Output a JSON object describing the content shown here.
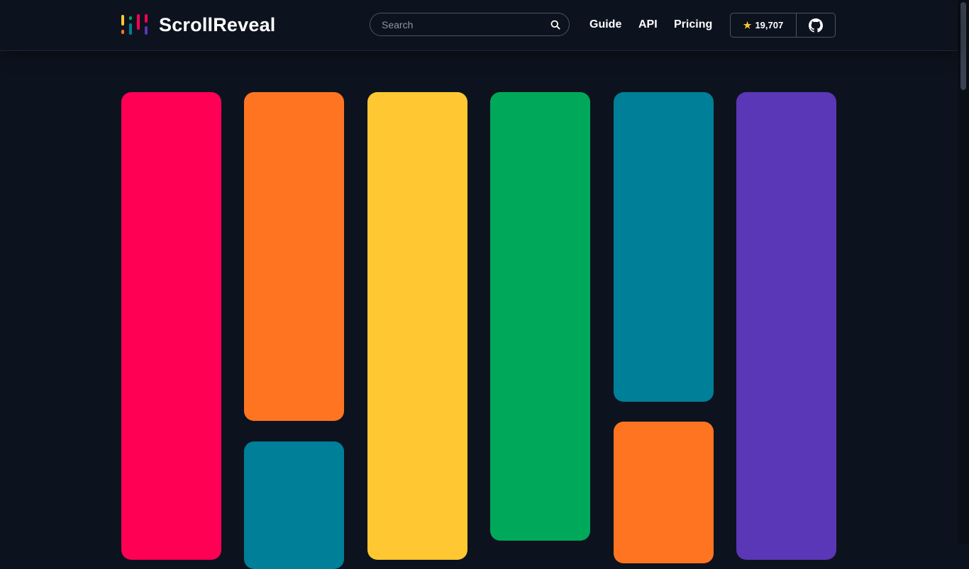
{
  "header": {
    "logo_text": "ScrollReveal",
    "search": {
      "placeholder": "Search",
      "value": ""
    },
    "nav": [
      {
        "label": "Guide"
      },
      {
        "label": "API"
      },
      {
        "label": "Pricing"
      }
    ],
    "github": {
      "stars": "19,707",
      "icon": "github-icon"
    }
  },
  "colors": {
    "background": "#0d131e",
    "pink": "#ff0055",
    "orange": "#ff7421",
    "yellow": "#ffc832",
    "green": "#00a95a",
    "teal": "#007f98",
    "purple": "#5a37b6",
    "star": "#fbc531"
  },
  "logo_bar_colors": [
    "#ffc832",
    "#ff7421",
    "#00a95a",
    "#007f98",
    "#ff0055",
    "#5a37b6"
  ],
  "blocks": [
    {
      "color": "pink"
    },
    {
      "color": "orange"
    },
    {
      "color": "teal"
    },
    {
      "color": "yellow"
    },
    {
      "color": "green"
    },
    {
      "color": "teal"
    },
    {
      "color": "orange"
    },
    {
      "color": "purple"
    }
  ]
}
